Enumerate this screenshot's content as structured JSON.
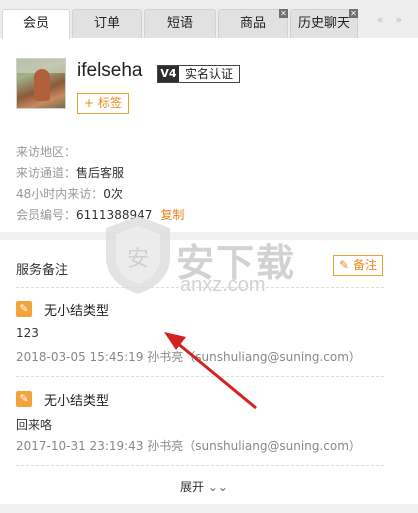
{
  "tabs": [
    {
      "label": "会员",
      "active": true,
      "closable": false
    },
    {
      "label": "订单",
      "active": false,
      "closable": false
    },
    {
      "label": "短语",
      "active": false,
      "closable": false
    },
    {
      "label": "商品",
      "active": false,
      "closable": true
    },
    {
      "label": "历史聊天",
      "active": false,
      "closable": true
    }
  ],
  "tab_nav": "« »",
  "profile": {
    "username": "ifelseha",
    "level": "V4",
    "verify_label": "实名认证",
    "tag_button": "+ 标签"
  },
  "info": {
    "region_label": "来访地区：",
    "region_value": "",
    "channel_label": "来访通道：",
    "channel_value": "售后客服",
    "visits_label": "48小时内来访：",
    "visits_value": "0次",
    "member_label": "会员编号：",
    "member_value": "6111388947",
    "copy_label": "复制"
  },
  "service_notes": {
    "title": "服务备注",
    "note_button": "备注",
    "items": [
      {
        "type": "无小结类型",
        "content": "123",
        "meta": "2018-03-05 15:45:19 孙书亮（sunshuliang@suning.com）"
      },
      {
        "type": "无小结类型",
        "content": "回来咯",
        "meta": "2017-10-31 23:19:43 孙书亮（sunshuliang@suning.com）"
      }
    ],
    "expand_label": "展开"
  },
  "watermark": {
    "title": "安下载",
    "sub": "anxz.com",
    "badge": "安"
  },
  "colors": {
    "accent": "#e88b1a",
    "arrow": "#d42222"
  }
}
